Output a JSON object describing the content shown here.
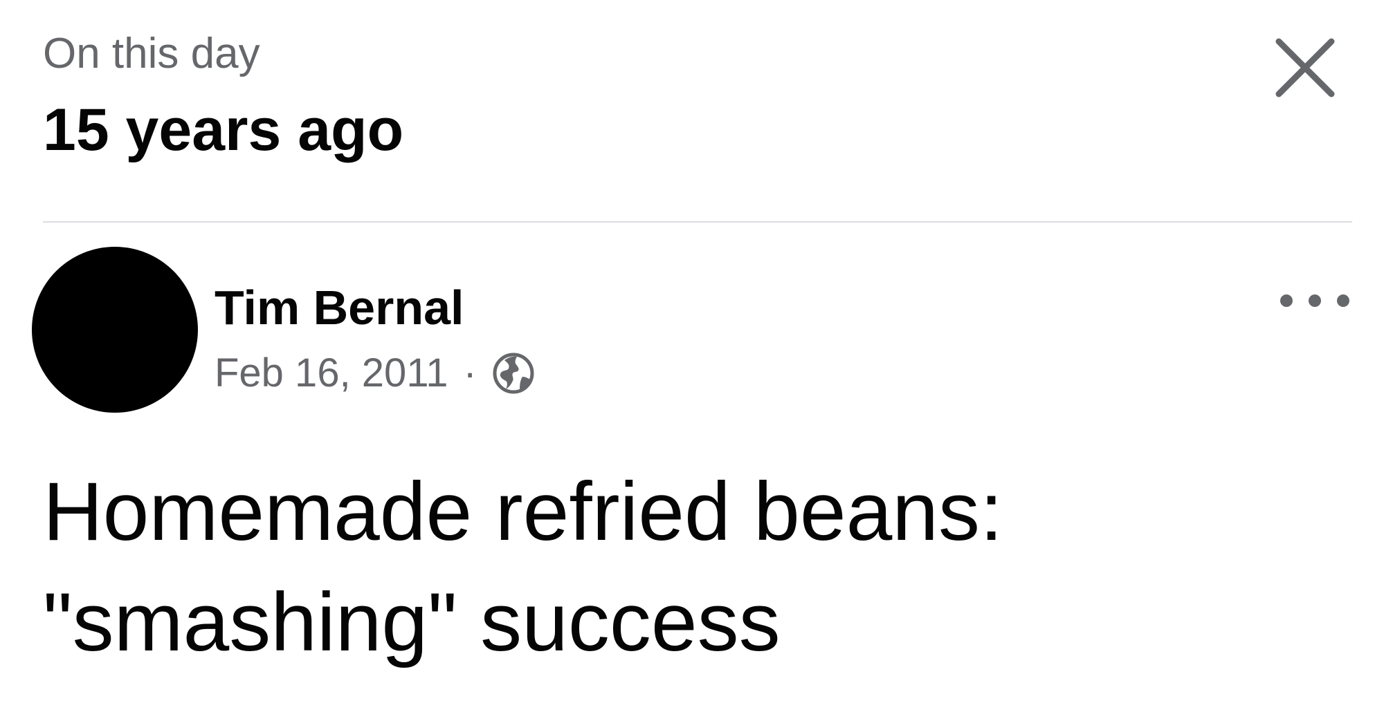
{
  "header": {
    "subtitle": "On this day",
    "title": "15 years ago",
    "close_icon": "close-icon"
  },
  "post": {
    "author": "Tim Bernal",
    "date": "Feb 16, 2011",
    "separator": "·",
    "privacy_icon": "globe-icon",
    "more_icon": "more-horizontal-icon",
    "text": "Homemade refried beans: \"smashing\" success"
  },
  "colors": {
    "primary_text": "#050505",
    "secondary_text": "#65676b",
    "divider": "#dadde1",
    "avatar": "#000000"
  }
}
